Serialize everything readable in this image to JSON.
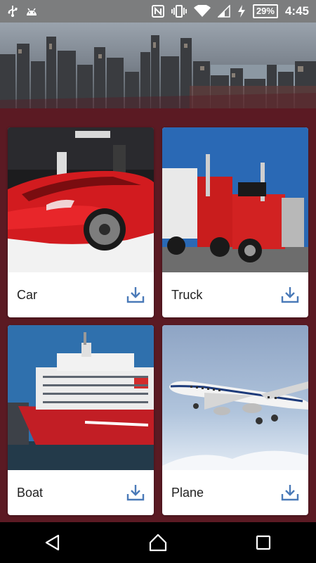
{
  "status_bar": {
    "icons_left": [
      "usb-icon",
      "android-debug-icon"
    ],
    "icons_right": [
      "nfc-icon",
      "vibrate-icon",
      "wifi-icon",
      "signal-icon",
      "charging-icon"
    ],
    "battery": "29%",
    "time": "4:45"
  },
  "header": {
    "image": "city-skyline"
  },
  "cards": [
    {
      "label": "Car",
      "image": "red-sports-car",
      "action_icon": "download-icon"
    },
    {
      "label": "Truck",
      "image": "red-semi-truck",
      "action_icon": "download-icon"
    },
    {
      "label": "Boat",
      "image": "red-white-ferry",
      "action_icon": "download-icon"
    },
    {
      "label": "Plane",
      "image": "passenger-jet",
      "action_icon": "download-icon"
    }
  ],
  "nav": {
    "buttons": [
      "back-icon",
      "home-icon",
      "recents-icon"
    ]
  },
  "colors": {
    "background": "#5b1a23",
    "accent_icon": "#4a7ab8",
    "status_bar": "#7c7d7e",
    "nav_bar": "#000000"
  }
}
